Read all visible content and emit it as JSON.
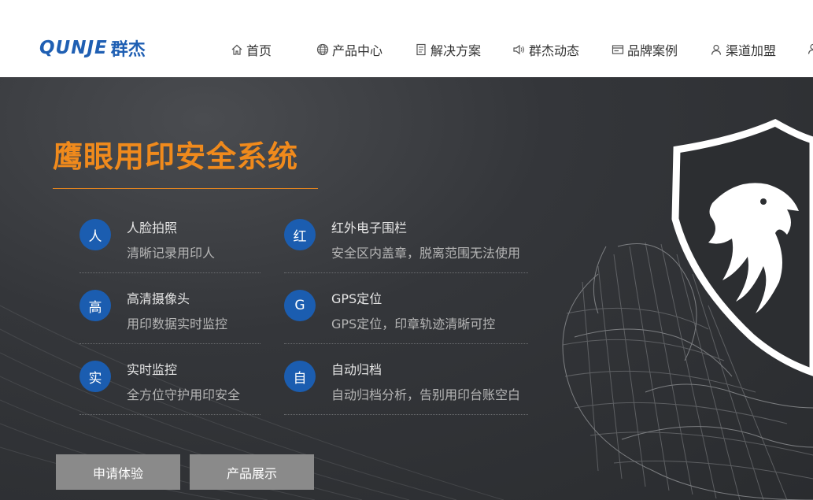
{
  "brand": {
    "logo_en": "QUNJE",
    "logo_cn": "群杰"
  },
  "nav": [
    {
      "label": "首页",
      "icon": "home-icon"
    },
    {
      "label": "产品中心",
      "icon": "globe-icon"
    },
    {
      "label": "解决方案",
      "icon": "document-icon"
    },
    {
      "label": "群杰动态",
      "icon": "speaker-icon"
    },
    {
      "label": "品牌案例",
      "icon": "card-icon"
    },
    {
      "label": "渠道加盟",
      "icon": "user-icon"
    }
  ],
  "hero": {
    "title": "鹰眼用印安全系统",
    "features": [
      {
        "badge": "人",
        "title": "人脸拍照",
        "desc": "清晰记录用印人"
      },
      {
        "badge": "红",
        "title": "红外电子围栏",
        "desc": "安全区内盖章，脱离范围无法使用"
      },
      {
        "badge": "高",
        "title": "高清摄像头",
        "desc": "用印数据实时监控"
      },
      {
        "badge": "G",
        "title": "GPS定位",
        "desc": "GPS定位，印章轨迹清晰可控"
      },
      {
        "badge": "实",
        "title": "实时监控",
        "desc": "全方位守护用印安全"
      },
      {
        "badge": "自",
        "title": "自动归档",
        "desc": "自动归档分析，告别用印台账空白"
      }
    ],
    "buttons": {
      "apply": "申请体验",
      "products": "产品展示"
    }
  },
  "colors": {
    "accent": "#f08a1c",
    "brand_blue": "#1f5fb3",
    "badge_blue": "#1b5db0",
    "button_gray": "#8a8a8a"
  }
}
